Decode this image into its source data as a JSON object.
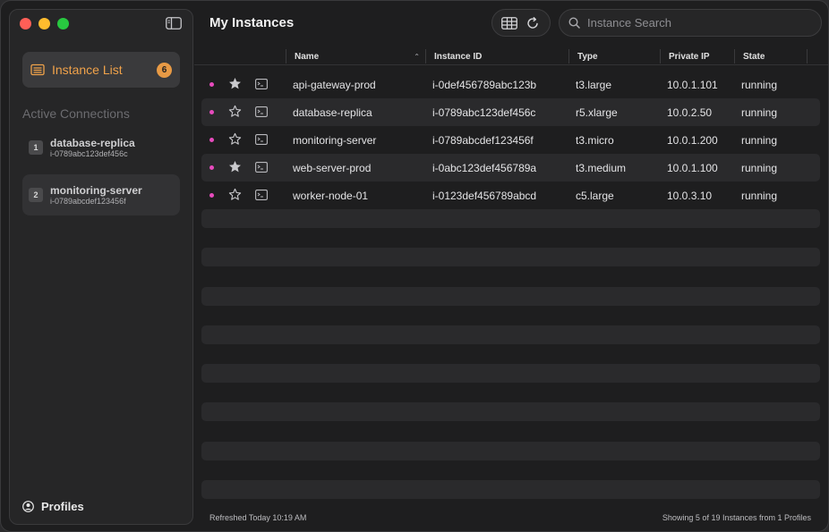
{
  "sidebar": {
    "nav_item_label": "Instance List",
    "nav_item_badge": "6",
    "section_title": "Active Connections",
    "connections": [
      {
        "index": "1",
        "name": "database-replica",
        "id": "i-0789abc123def456c"
      },
      {
        "index": "2",
        "name": "monitoring-server",
        "id": "i-0789abcdef123456f"
      }
    ],
    "profiles_label": "Profiles"
  },
  "header": {
    "title": "My Instances",
    "search_placeholder": "Instance Search"
  },
  "table": {
    "columns": [
      "Name",
      "Instance ID",
      "Type",
      "Private IP",
      "State"
    ],
    "rows": [
      {
        "starred": true,
        "name": "api-gateway-prod",
        "id": "i-0def456789abc123b",
        "type": "t3.large",
        "ip": "10.0.1.101",
        "state": "running"
      },
      {
        "starred": false,
        "name": "database-replica",
        "id": "i-0789abc123def456c",
        "type": "r5.xlarge",
        "ip": "10.0.2.50",
        "state": "running"
      },
      {
        "starred": false,
        "name": "monitoring-server",
        "id": "i-0789abcdef123456f",
        "type": "t3.micro",
        "ip": "10.0.1.200",
        "state": "running"
      },
      {
        "starred": true,
        "name": "web-server-prod",
        "id": "i-0abc123def456789a",
        "type": "t3.medium",
        "ip": "10.0.1.100",
        "state": "running"
      },
      {
        "starred": false,
        "name": "worker-node-01",
        "id": "i-0123def456789abcd",
        "type": "c5.large",
        "ip": "10.0.3.10",
        "state": "running"
      }
    ]
  },
  "footer": {
    "refreshed": "Refreshed Today 10:19 AM",
    "showing": "Showing 5 of 19 Instances from 1 Profiles"
  },
  "colors": {
    "accent": "#f0a24a",
    "status_dot": "#e74bbd"
  }
}
